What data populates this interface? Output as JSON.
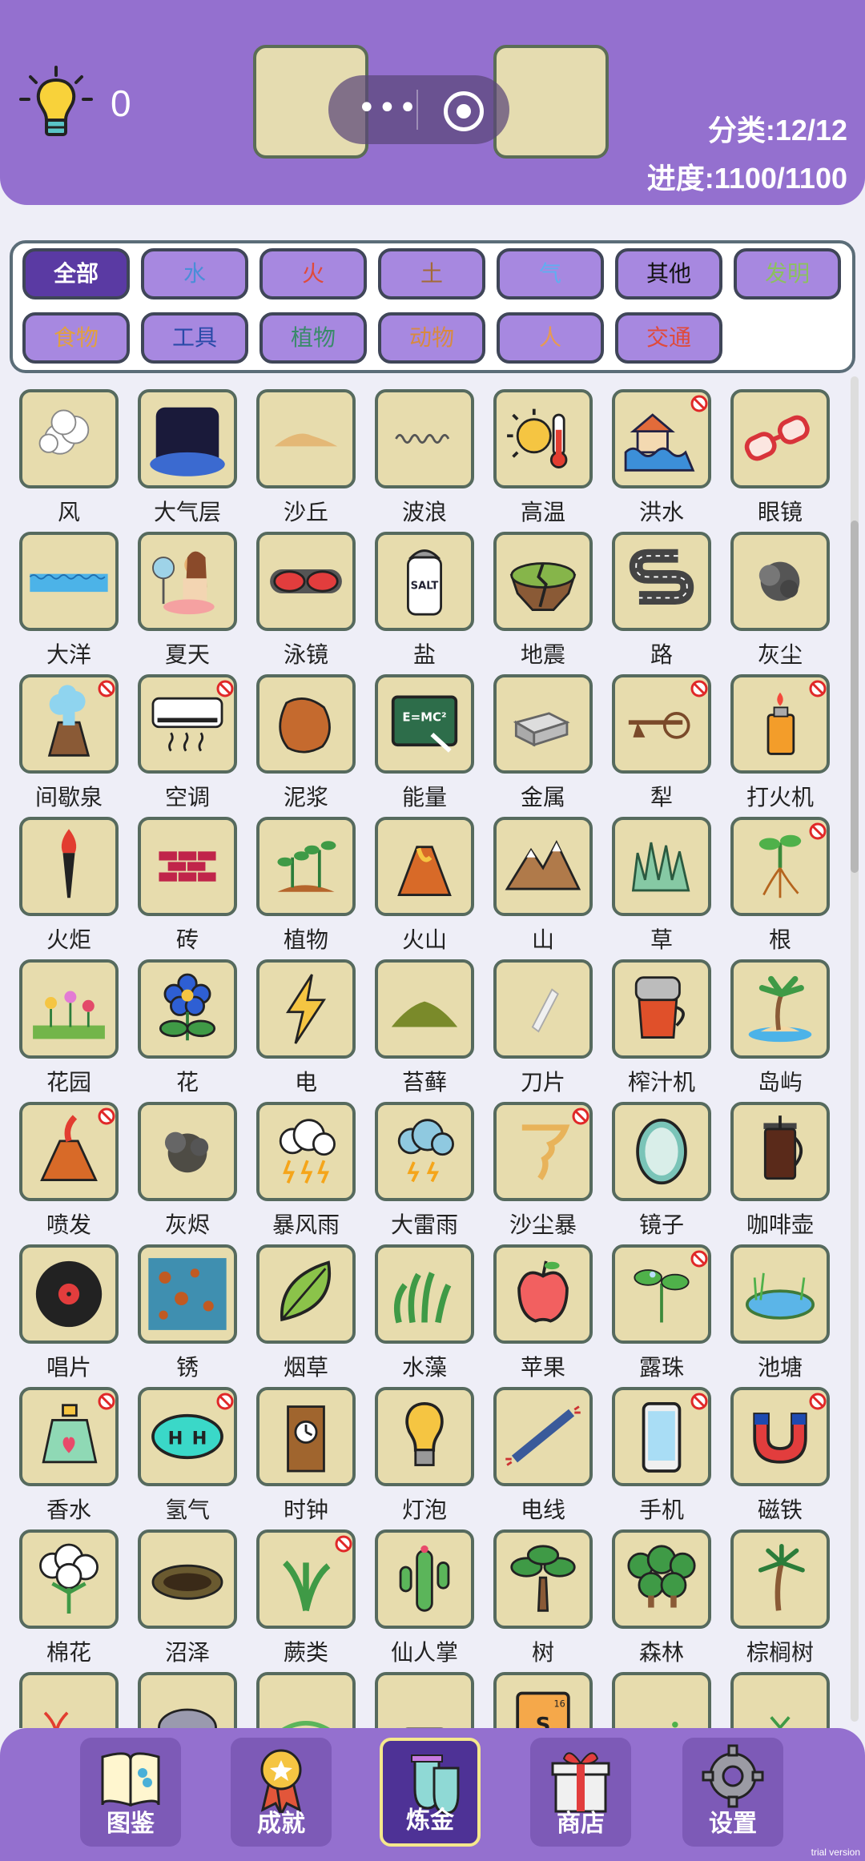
{
  "header": {
    "hint_count": "0",
    "category_progress": "分类:12/12",
    "overall_progress": "进度:1100/1100"
  },
  "filters": [
    {
      "label": "全部",
      "color": "#ffffff",
      "active": true
    },
    {
      "label": "水",
      "color": "#4a8ed8"
    },
    {
      "label": "火",
      "color": "#e04a3a"
    },
    {
      "label": "土",
      "color": "#a46a36"
    },
    {
      "label": "气",
      "color": "#60aef0"
    },
    {
      "label": "其他",
      "color": "#111111"
    },
    {
      "label": "发明",
      "color": "#8cc060"
    },
    {
      "label": "食物",
      "color": "#e2a040"
    },
    {
      "label": "工具",
      "color": "#2a4aa8"
    },
    {
      "label": "植物",
      "color": "#3a8a6a"
    },
    {
      "label": "动物",
      "color": "#d88a40"
    },
    {
      "label": "人",
      "color": "#e79a52"
    },
    {
      "label": "交通",
      "color": "#e04a3a"
    }
  ],
  "elements": [
    {
      "name": "风",
      "icon": "wind-icon"
    },
    {
      "name": "大气层",
      "icon": "atmosphere-icon"
    },
    {
      "name": "沙丘",
      "icon": "dune-icon"
    },
    {
      "name": "波浪",
      "icon": "wave-icon"
    },
    {
      "name": "高温",
      "icon": "heat-icon"
    },
    {
      "name": "洪水",
      "icon": "flood-icon",
      "banned": true
    },
    {
      "name": "眼镜",
      "icon": "glasses-icon"
    },
    {
      "name": "大洋",
      "icon": "ocean-icon"
    },
    {
      "name": "夏天",
      "icon": "summer-icon"
    },
    {
      "name": "泳镜",
      "icon": "goggles-icon"
    },
    {
      "name": "盐",
      "icon": "salt-icon"
    },
    {
      "name": "地震",
      "icon": "earthquake-icon"
    },
    {
      "name": "路",
      "icon": "road-icon"
    },
    {
      "name": "灰尘",
      "icon": "dust-icon"
    },
    {
      "name": "间歇泉",
      "icon": "geyser-icon",
      "banned": true
    },
    {
      "name": "空调",
      "icon": "air-conditioner-icon",
      "banned": true
    },
    {
      "name": "泥浆",
      "icon": "mud-icon"
    },
    {
      "name": "能量",
      "icon": "energy-icon"
    },
    {
      "name": "金属",
      "icon": "metal-icon"
    },
    {
      "name": "犁",
      "icon": "plow-icon",
      "banned": true
    },
    {
      "name": "打火机",
      "icon": "lighter-icon",
      "banned": true
    },
    {
      "name": "火炬",
      "icon": "torch-icon"
    },
    {
      "name": "砖",
      "icon": "brick-icon"
    },
    {
      "name": "植物",
      "icon": "plant-icon"
    },
    {
      "name": "火山",
      "icon": "volcano-icon"
    },
    {
      "name": "山",
      "icon": "mountain-icon"
    },
    {
      "name": "草",
      "icon": "grass-icon"
    },
    {
      "name": "根",
      "icon": "root-icon",
      "banned": true
    },
    {
      "name": "花园",
      "icon": "garden-icon"
    },
    {
      "name": "花",
      "icon": "flower-icon"
    },
    {
      "name": "电",
      "icon": "electricity-icon"
    },
    {
      "name": "苔藓",
      "icon": "moss-icon"
    },
    {
      "name": "刀片",
      "icon": "blade-icon"
    },
    {
      "name": "榨汁机",
      "icon": "juicer-icon"
    },
    {
      "name": "岛屿",
      "icon": "island-icon"
    },
    {
      "name": "喷发",
      "icon": "eruption-icon",
      "banned": true
    },
    {
      "name": "灰烬",
      "icon": "ash-icon"
    },
    {
      "name": "暴风雨",
      "icon": "storm-icon"
    },
    {
      "name": "大雷雨",
      "icon": "thunderstorm-icon"
    },
    {
      "name": "沙尘暴",
      "icon": "sandstorm-icon",
      "banned": true
    },
    {
      "name": "镜子",
      "icon": "mirror-icon"
    },
    {
      "name": "咖啡壶",
      "icon": "coffee-pot-icon"
    },
    {
      "name": "唱片",
      "icon": "record-icon"
    },
    {
      "name": "锈",
      "icon": "rust-icon"
    },
    {
      "name": "烟草",
      "icon": "tobacco-icon"
    },
    {
      "name": "水藻",
      "icon": "algae-icon"
    },
    {
      "name": "苹果",
      "icon": "apple-icon"
    },
    {
      "name": "露珠",
      "icon": "dew-icon",
      "banned": true
    },
    {
      "name": "池塘",
      "icon": "pond-icon"
    },
    {
      "name": "香水",
      "icon": "perfume-icon",
      "banned": true
    },
    {
      "name": "氢气",
      "icon": "hydrogen-icon",
      "banned": true
    },
    {
      "name": "时钟",
      "icon": "clock-icon"
    },
    {
      "name": "灯泡",
      "icon": "light-bulb-icon"
    },
    {
      "name": "电线",
      "icon": "wire-icon"
    },
    {
      "name": "手机",
      "icon": "phone-icon",
      "banned": true
    },
    {
      "name": "磁铁",
      "icon": "magnet-icon",
      "banned": true
    },
    {
      "name": "棉花",
      "icon": "cotton-icon"
    },
    {
      "name": "沼泽",
      "icon": "swamp-icon"
    },
    {
      "name": "蕨类",
      "icon": "fern-icon",
      "banned": true
    },
    {
      "name": "仙人掌",
      "icon": "cactus-icon"
    },
    {
      "name": "树",
      "icon": "tree-icon"
    },
    {
      "name": "森林",
      "icon": "forest-icon"
    },
    {
      "name": "棕榈树",
      "icon": "palm-tree-icon"
    },
    {
      "name": "",
      "icon": "dna-icon"
    },
    {
      "name": "",
      "icon": "elephant-icon"
    },
    {
      "name": "",
      "icon": "snail-icon"
    },
    {
      "name": "",
      "icon": "car-icon"
    },
    {
      "name": "",
      "icon": "sulfur-icon"
    },
    {
      "name": "",
      "icon": "bacteria-icon"
    },
    {
      "name": "",
      "icon": "sprout-icon"
    }
  ],
  "nav": [
    {
      "label": "图鉴",
      "icon": "book-icon"
    },
    {
      "label": "成就",
      "icon": "medal-icon"
    },
    {
      "label": "炼金",
      "icon": "flask-icon",
      "active": true
    },
    {
      "label": "商店",
      "icon": "gift-icon"
    },
    {
      "label": "设置",
      "icon": "gear-icon"
    }
  ],
  "watermark": "trial version"
}
